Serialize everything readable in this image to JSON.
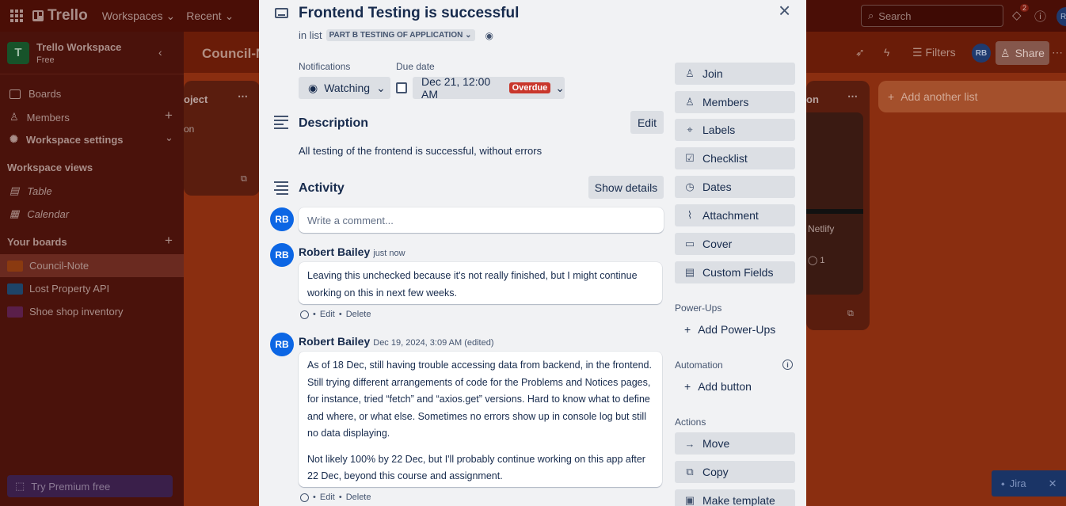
{
  "topbar": {
    "app_name": "Trello",
    "nav": [
      "Workspaces",
      "Recent"
    ],
    "search_placeholder": "Search",
    "notification_count": "2",
    "user_initials": "RB"
  },
  "sidebar": {
    "workspace_initial": "T",
    "workspace_name": "Trello Workspace",
    "workspace_plan": "Free",
    "items": [
      {
        "label": "Boards"
      },
      {
        "label": "Members"
      },
      {
        "label": "Workspace settings"
      }
    ],
    "views_header": "Workspace views",
    "views": [
      {
        "label": "Table"
      },
      {
        "label": "Calendar"
      }
    ],
    "boards_header": "Your boards",
    "boards": [
      {
        "label": "Council-Note",
        "color": "#8a3a10"
      },
      {
        "label": "Lost Property API",
        "color": "#1e4468"
      },
      {
        "label": "Shoe shop inventory",
        "color": "#5a1f4a"
      }
    ],
    "premium": "Try Premium free"
  },
  "board": {
    "title": "Council-N",
    "filters": "Filters",
    "share": "Share",
    "avatar": "RB",
    "add_list": "Add another list",
    "partial_list_1": "oject",
    "partial_list_1_card": "on",
    "partial_list_2": "on",
    "partial_card_text": "Netlify",
    "partial_comment_count": "1"
  },
  "jira": {
    "label": "Jira"
  },
  "card": {
    "title": "Frontend Testing is successful",
    "in_list_prefix": "in list",
    "list_name": "PART B TESTING OF APPLICATION",
    "notifications_label": "Notifications",
    "watching": "Watching",
    "due_label": "Due date",
    "due_value": "Dec 21, 12:00 AM",
    "overdue": "Overdue",
    "description_title": "Description",
    "edit": "Edit",
    "description_text": "All testing of the frontend is successful, without errors",
    "activity_title": "Activity",
    "show_details": "Show details",
    "comment_placeholder": "Write a comment...",
    "user_initials": "RB",
    "comments": [
      {
        "author": "Robert Bailey",
        "time": "just now",
        "paragraphs": [
          "Leaving this unchecked because it's not really finished, but I might continue working on this in next few weeks."
        ]
      },
      {
        "author": "Robert Bailey",
        "time": "Dec 19, 2024, 3:09 AM (edited)",
        "paragraphs": [
          "As of 18 Dec, still having trouble accessing data from backend, in the frontend. Still trying different arrangements of code for the Problems and Notices pages, for instance, tried “fetch” and “axios.get” versions. Hard to know what to define and where, or what else. Sometimes no errors show up in console log but still no data displaying.",
          "Not likely 100% by 22 Dec, but I'll probably continue working on this app after 22 Dec, beyond this course and assignment."
        ]
      }
    ],
    "comment_edit": "Edit",
    "comment_delete": "Delete",
    "sidebar_buttons": [
      "Join",
      "Members",
      "Labels",
      "Checklist",
      "Dates",
      "Attachment",
      "Cover",
      "Custom Fields"
    ],
    "powerups_header": "Power-Ups",
    "add_powerups": "Add Power-Ups",
    "automation_header": "Automation",
    "add_button": "Add button",
    "actions_header": "Actions",
    "action_buttons": [
      "Move",
      "Copy",
      "Make template"
    ]
  }
}
